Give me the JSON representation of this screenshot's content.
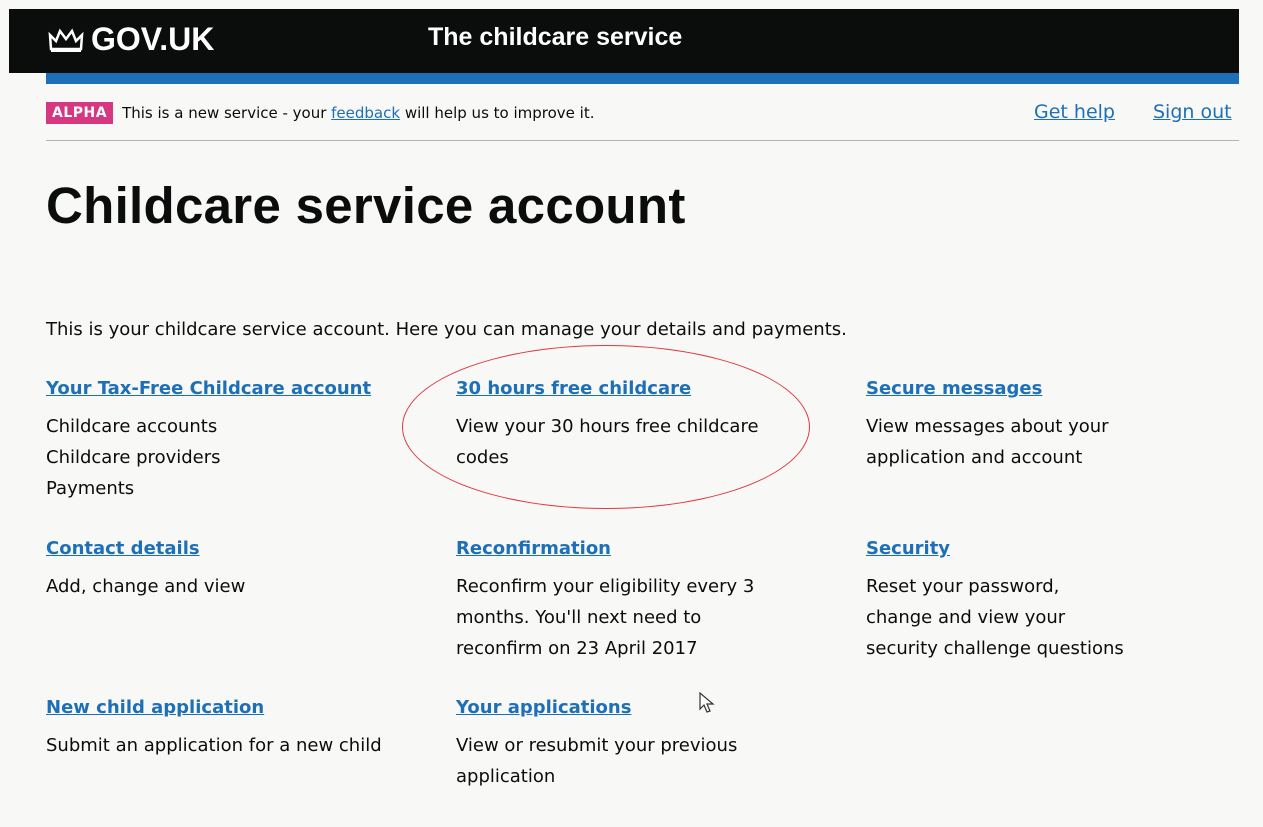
{
  "header": {
    "logo_text": "GOV.UK",
    "service_name": "The childcare service"
  },
  "phase_banner": {
    "tag": "ALPHA",
    "text_before": "This is a new service - your ",
    "feedback_link": "feedback",
    "text_after": " will help us to improve it."
  },
  "top_links": {
    "help": "Get help",
    "sign_out": "Sign out"
  },
  "page": {
    "title": "Childcare service account",
    "intro": "This is your childcare service account. Here you can manage your details and payments."
  },
  "sections": [
    {
      "title": "Your Tax-Free Childcare account",
      "lines": [
        "Childcare accounts",
        "Childcare providers",
        "Payments"
      ]
    },
    {
      "title": "30 hours free childcare",
      "lines": [
        "View your 30 hours free childcare",
        "codes"
      ]
    },
    {
      "title": "Secure messages",
      "lines": [
        "View messages about your",
        "application and account"
      ]
    },
    {
      "title": "Contact details",
      "lines": [
        "Add, change and view"
      ]
    },
    {
      "title": "Reconfirmation",
      "lines": [
        "Reconfirm your eligibility every 3",
        "months. You'll next need to",
        "reconfirm on 23 April 2017"
      ]
    },
    {
      "title": "Security",
      "lines": [
        "Reset your password,",
        "change and view your",
        "security challenge questions"
      ]
    },
    {
      "title": "New child application",
      "lines": [
        "Submit an application for a new child"
      ]
    },
    {
      "title": "Your applications",
      "lines": [
        "View or resubmit your previous",
        "application"
      ]
    }
  ],
  "colors": {
    "link": "#1d70b8",
    "header": "#0b0c0c",
    "alpha": "#d53880",
    "highlight": "#e1373d"
  }
}
